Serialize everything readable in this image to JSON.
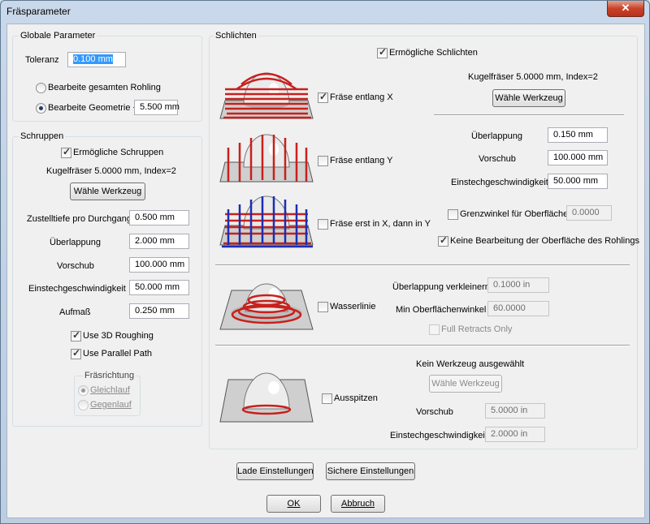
{
  "window": {
    "title": "Fräsparameter",
    "close_glyph": "✕"
  },
  "global": {
    "group_label": "Globale Parameter",
    "tolerance_label": "Toleranz",
    "tolerance_value": "0.100 mm",
    "radio_whole": "Bearbeite gesamten Rohling",
    "radio_geometry": "Bearbeite Geometrie +",
    "geometry_offset": "5.500 mm"
  },
  "roughing": {
    "group_label": "Schruppen",
    "enable": "Ermögliche Schruppen",
    "tool_info": "Kugelfräser 5.0000 mm, Index=2",
    "choose_tool": "Wähle Werkzeug",
    "rows": [
      {
        "label": "Zustelltiefe pro Durchgang",
        "value": "0.500 mm"
      },
      {
        "label": "Überlappung",
        "value": "2.000 mm"
      },
      {
        "label": "Vorschub",
        "value": "100.000 mm"
      },
      {
        "label": "Einstechgeschwindigkeit",
        "value": "50.000 mm"
      },
      {
        "label": "Aufmaß",
        "value": "0.250 mm"
      }
    ],
    "use_3d": "Use 3D Roughing",
    "use_parallel": "Use Parallel Path",
    "direction_label": "Fräsrichtung",
    "climb": "Gleichlauf",
    "conventional": "Gegenlauf"
  },
  "finishing": {
    "group_label": "Schlichten",
    "enable": "Ermögliche Schlichten",
    "along_x": "Fräse entlang X",
    "along_y": "Fräse entlang Y",
    "x_then_y": "Fräse erst in X, dann in Y",
    "tool_info": "Kugelfräser 5.0000 mm, Index=2",
    "choose_tool": "Wähle Werkzeug",
    "overlap_label": "Überlappung",
    "overlap_value": "0.150 mm",
    "feed_label": "Vorschub",
    "feed_value": "100.000 mm",
    "plunge_label": "Einstechgeschwindigkeit",
    "plunge_value": "50.000 mm",
    "limit_angle": "Grenzwinkel für Oberfläche",
    "limit_angle_value": "0.0000",
    "no_surface": "Keine Bearbeitung der Oberfläche des Rohlings",
    "waterline": "Wasserlinie",
    "overlap_reduce_label": "Überlappung verkleinern",
    "overlap_reduce_value": "0.1000 in",
    "min_angle_label": "Min Oberflächenwinkel",
    "min_angle_value": "60.0000",
    "full_retracts": "Full Retracts Only",
    "pencil": "Ausspitzen",
    "no_tool": "Kein Werkzeug ausgewählt",
    "pencil_choose_tool": "Wähle Werkzeug",
    "pencil_feed_label": "Vorschub",
    "pencil_feed_value": "5.0000 in",
    "pencil_plunge_label": "Einstechgeschwindigkeit",
    "pencil_plunge_value": "2.0000 in"
  },
  "footer": {
    "load": "Lade Einstellungen",
    "save": "Sichere Einstellungen",
    "ok": "OK",
    "cancel": "Abbruch"
  },
  "colors": {
    "toolpath_red": "#c8201c",
    "toolpath_blue": "#1c2db4",
    "accent": "#3399ff"
  }
}
